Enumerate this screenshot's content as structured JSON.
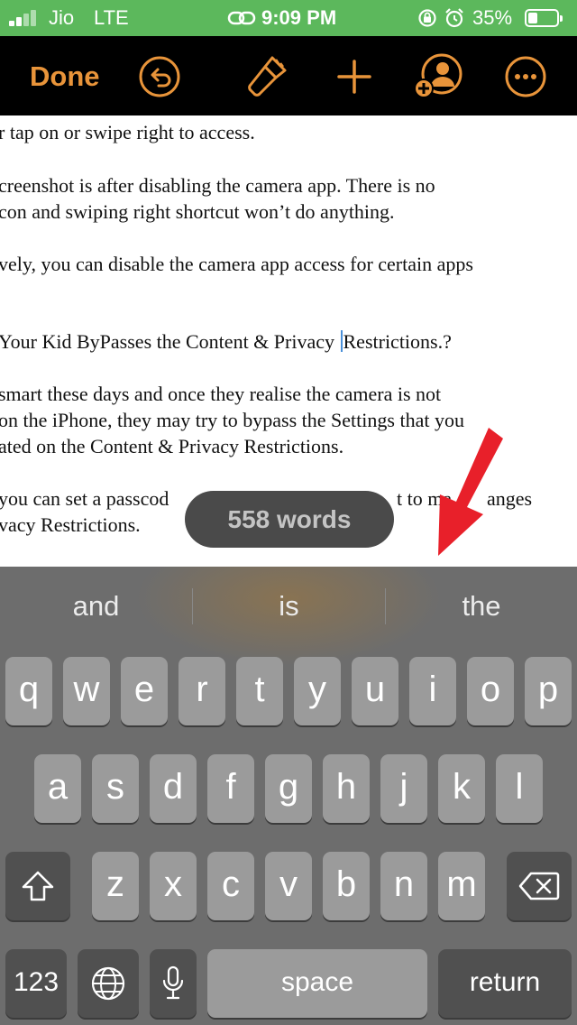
{
  "status_bar": {
    "carrier": "Jio",
    "network": "LTE",
    "time": "9:09 PM",
    "battery_percent": "35%",
    "icons": [
      "signal-icon",
      "link-icon",
      "orientation-lock-icon",
      "alarm-icon",
      "battery-icon"
    ]
  },
  "toolbar": {
    "done_label": "Done",
    "icons": [
      "undo-icon",
      "paintbrush-icon",
      "add-icon",
      "collaborate-icon",
      "more-icon"
    ],
    "accent_color": "#e8943a"
  },
  "document": {
    "lines": [
      "r tap on or swipe right to access.",
      "creenshot is after disabling the camera app. There is no",
      "con and swiping right shortcut won’t do anything.",
      "vely, you can disable the camera app access for certain apps",
      "Your Kid ByPasses the Content & Privacy ",
      "Restrictions.?",
      "smart these days and once they realise the camera is not",
      " on the iPhone, they may try to bypass the Settings that you",
      "ated on the Content & Privacy Restrictions.",
      "you can set a passcod",
      "t to ma",
      "anges",
      "vacy Restrictions."
    ]
  },
  "word_count": "558 words",
  "keyboard": {
    "suggestions": [
      "and",
      "is",
      "the"
    ],
    "row1": [
      "q",
      "w",
      "e",
      "r",
      "t",
      "y",
      "u",
      "i",
      "o",
      "p"
    ],
    "row2": [
      "a",
      "s",
      "d",
      "f",
      "g",
      "h",
      "j",
      "k",
      "l"
    ],
    "row3": [
      "z",
      "x",
      "c",
      "v",
      "b",
      "n",
      "m"
    ],
    "numbers_label": "123",
    "space_label": "space",
    "return_label": "return",
    "icons": [
      "shift-icon",
      "delete-icon",
      "globe-icon",
      "microphone-icon"
    ]
  },
  "annotation": {
    "arrow_color": "#e8202a"
  }
}
